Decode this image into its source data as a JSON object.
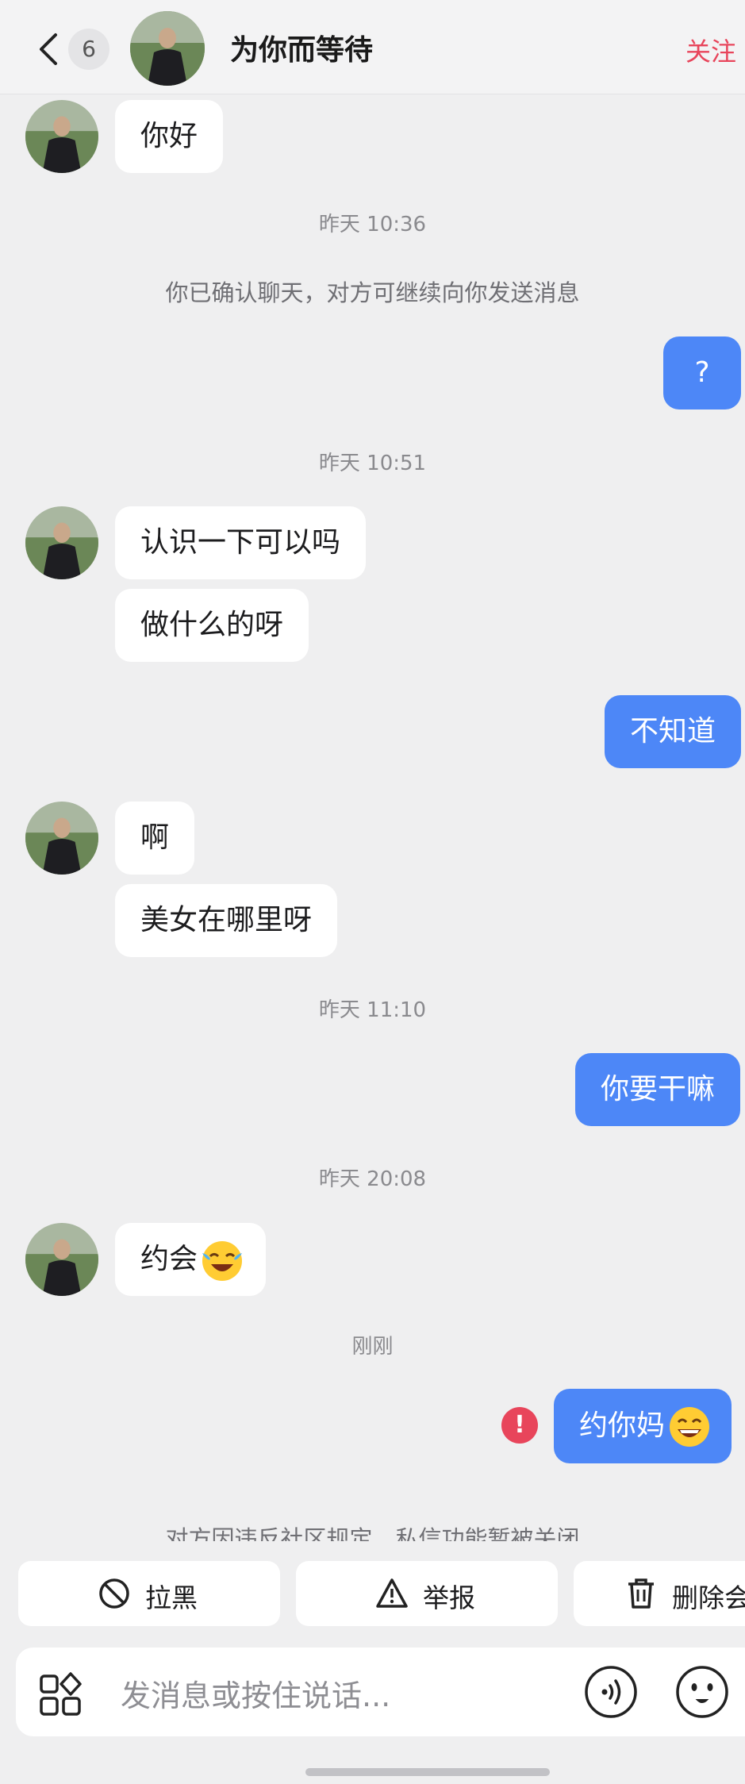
{
  "header": {
    "unread_count": "6",
    "contact_name": "为你而等待",
    "follow_label": "关注"
  },
  "messages": {
    "m1": "你好",
    "t1": "昨天 10:36",
    "sys1": "你已确认聊天，对方可继续向你发送消息",
    "m2": "?",
    "t2": "昨天 10:51",
    "m3": "认识一下可以吗",
    "m4": "做什么的呀",
    "m5": "不知道",
    "m6": "啊",
    "m7": "美女在哪里呀",
    "t3": "昨天 11:10",
    "m8": "你要干嘛",
    "t4": "昨天 20:08",
    "m9": "约会",
    "t5": "刚刚",
    "m10": "约你妈",
    "error_mark": "!",
    "notice": "对方因违反社区规定，私信功能暂被关闭"
  },
  "actions": {
    "block": "拉黑",
    "report": "举报",
    "delete": "删除会"
  },
  "input": {
    "placeholder": "发消息或按住说话..."
  },
  "colors": {
    "outgoing_bubble": "#4d87f7",
    "follow": "#e8455b",
    "background": "#efeff0"
  }
}
